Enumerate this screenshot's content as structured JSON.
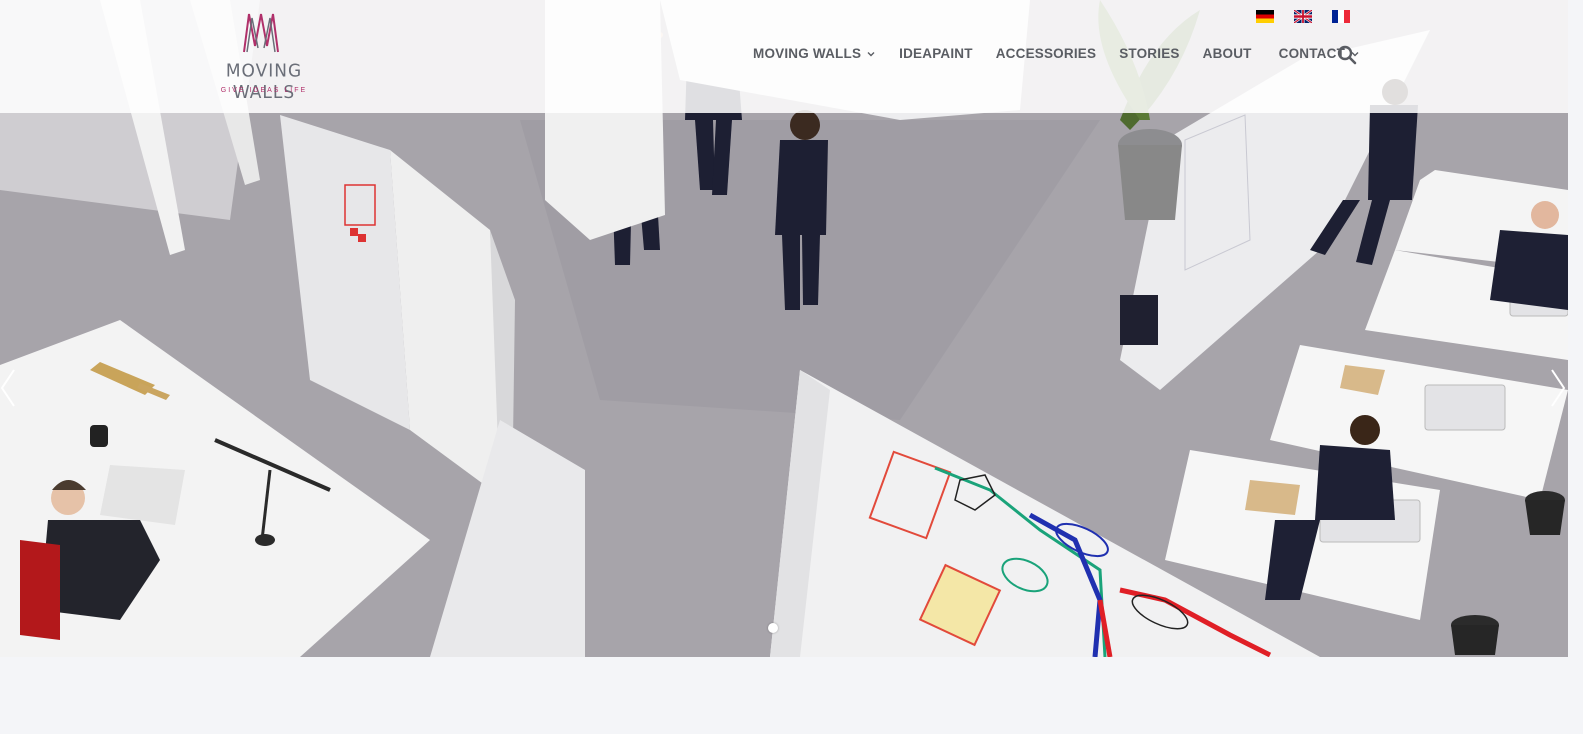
{
  "brand": {
    "name": "MOVING WALLS",
    "tagline": "GIVE IDEAS LIFE",
    "colors": {
      "accent": "#b0306a",
      "text": "#5a5d63"
    }
  },
  "languages": [
    {
      "code": "de",
      "icon": "flag-germany-icon"
    },
    {
      "code": "en",
      "icon": "flag-uk-icon"
    },
    {
      "code": "fr",
      "icon": "flag-france-icon"
    }
  ],
  "nav": {
    "items": [
      {
        "label": "MOVING WALLS",
        "has_dropdown": true
      },
      {
        "label": "IDEAPAINT",
        "has_dropdown": false
      },
      {
        "label": "ACCESSORIES",
        "has_dropdown": false
      },
      {
        "label": "STORIES",
        "has_dropdown": false
      },
      {
        "label": "ABOUT",
        "has_dropdown": false
      },
      {
        "label": "CONTACT",
        "has_dropdown": true
      }
    ],
    "search_icon": "search-icon"
  },
  "slider": {
    "prev_icon": "chevron-left-icon",
    "next_icon": "chevron-right-icon",
    "slide_count_visible": 1,
    "active_slide": 1
  }
}
